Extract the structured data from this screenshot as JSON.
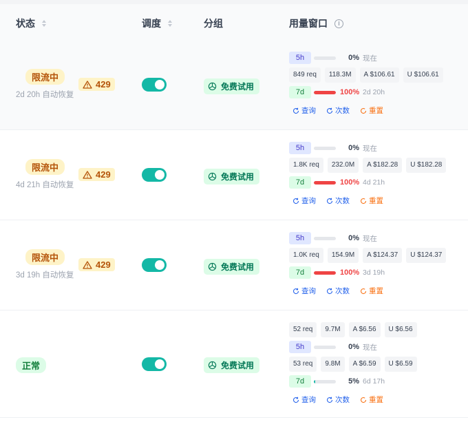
{
  "header": {
    "status": "状态",
    "schedule": "调度",
    "group": "分组",
    "usage": "用量窗口",
    "info_glyph": "i"
  },
  "colors": {
    "toggle_on": "#14b8a6",
    "limit_pill_bg": "#fef3c7",
    "ok_pill_bg": "#dcfce7",
    "bar_red": "#ef4444"
  },
  "rows": [
    {
      "status": "限流中",
      "recover": "2d 20h 自动恢复",
      "badge": "429",
      "enabled": true,
      "group": "免费试用",
      "usage": {
        "w5h": {
          "label": "5h",
          "pct": "0%",
          "pct_value": 0,
          "when": "现在"
        },
        "stats": {
          "req": "849 req",
          "tokens": "118.3M",
          "a": "A $106.61",
          "u": "U $106.61"
        },
        "w7d": {
          "label": "7d",
          "pct": "100%",
          "pct_value": 100,
          "when": "2d 20h"
        }
      },
      "actions": {
        "query": "查询",
        "count": "次数",
        "reset": "重置"
      }
    },
    {
      "status": "限流中",
      "recover": "4d 21h 自动恢复",
      "badge": "429",
      "enabled": true,
      "group": "免费试用",
      "usage": {
        "w5h": {
          "label": "5h",
          "pct": "0%",
          "pct_value": 0,
          "when": "现在"
        },
        "stats": {
          "req": "1.8K req",
          "tokens": "232.0M",
          "a": "A $182.28",
          "u": "U $182.28"
        },
        "w7d": {
          "label": "7d",
          "pct": "100%",
          "pct_value": 100,
          "when": "4d 21h"
        }
      },
      "actions": {
        "query": "查询",
        "count": "次数",
        "reset": "重置"
      }
    },
    {
      "status": "限流中",
      "recover": "3d 19h 自动恢复",
      "badge": "429",
      "enabled": true,
      "group": "免费试用",
      "usage": {
        "w5h": {
          "label": "5h",
          "pct": "0%",
          "pct_value": 0,
          "when": "现在"
        },
        "stats": {
          "req": "1.0K req",
          "tokens": "154.9M",
          "a": "A $124.37",
          "u": "U $124.37"
        },
        "w7d": {
          "label": "7d",
          "pct": "100%",
          "pct_value": 100,
          "when": "3d 19h"
        }
      },
      "actions": {
        "query": "查询",
        "count": "次数",
        "reset": "重置"
      }
    },
    {
      "status": "正常",
      "enabled": true,
      "group": "免费试用",
      "usage": {
        "stats5h": {
          "req": "52 req",
          "tokens": "9.7M",
          "a": "A $6.56",
          "u": "U $6.56"
        },
        "w5h": {
          "label": "5h",
          "pct": "0%",
          "pct_value": 0,
          "when": "现在"
        },
        "stats7d": {
          "req": "53 req",
          "tokens": "9.8M",
          "a": "A $6.59",
          "u": "U $6.59"
        },
        "w7d": {
          "label": "7d",
          "pct": "5%",
          "pct_value": 5,
          "when": "6d 17h"
        }
      },
      "actions": {
        "query": "查询",
        "count": "次数",
        "reset": "重置"
      }
    }
  ]
}
